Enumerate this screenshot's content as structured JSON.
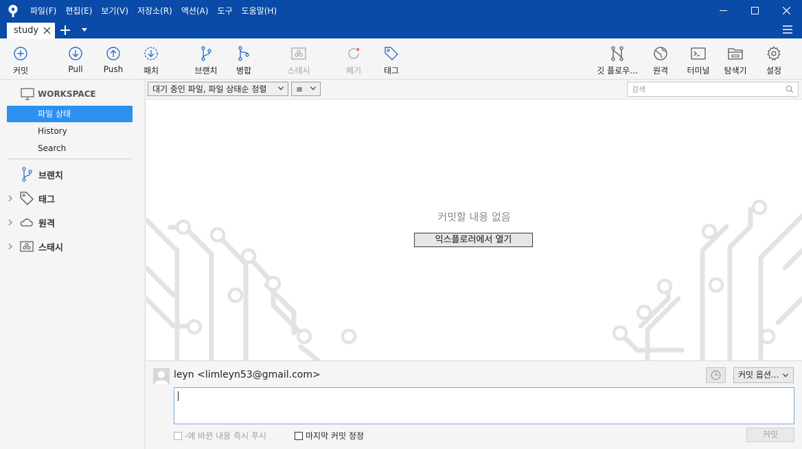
{
  "titlebar": {
    "menu": [
      "파일(F)",
      "편집(E)",
      "보기(V)",
      "저장소(R)",
      "액션(A)",
      "도구",
      "도움말(H)"
    ]
  },
  "tabs": {
    "active_tab": "study"
  },
  "toolbar": {
    "commit": "커밋",
    "pull": "Pull",
    "push": "Push",
    "fetch": "패치",
    "branch": "브랜치",
    "merge": "병합",
    "stash": "스태시",
    "discard": "폐기",
    "tag": "태그",
    "git_flow": "깃 플로우...",
    "remote": "원격",
    "terminal": "터미널",
    "explorer": "탐색기",
    "settings": "설정"
  },
  "sidebar": {
    "workspace": "WORKSPACE",
    "items": [
      "파일 상태",
      "History",
      "Search"
    ],
    "active_item": "파일 상태",
    "groups": {
      "branches": "브랜치",
      "tags": "태그",
      "remotes": "원격",
      "stashes": "스태시"
    }
  },
  "filter": {
    "sort_select": "대기 중인 파일, 파일 상태순 정렬",
    "view_select": "≡",
    "search_placeholder": "검색"
  },
  "main": {
    "empty_message": "커밋할 내용 없음",
    "open_explorer_button": "익스플로러에서 열기"
  },
  "commit_panel": {
    "author": "leyn <limleyn53@gmail.com>",
    "options_button": "커밋 옵션...",
    "push_immediately": "-에 바뀐 내용 즉시 푸시",
    "amend_last": "마지막 커밋 정정",
    "commit_button": "커밋",
    "message": ""
  },
  "colors": {
    "titlebar": "#0a4aa8",
    "accent": "#2d8ff0",
    "icon_blue": "#2a6fc9"
  }
}
